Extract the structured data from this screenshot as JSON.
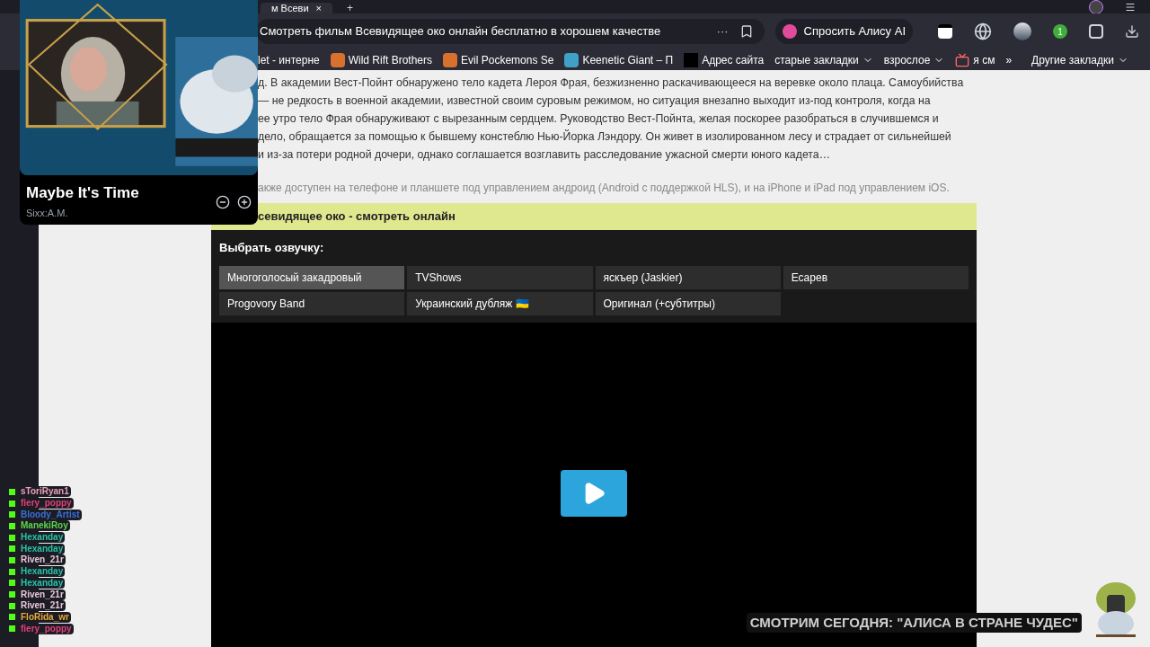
{
  "browser": {
    "tab": {
      "title": "м Всеви",
      "close": "×"
    },
    "new_tab": "+",
    "address": "Смотреть фильм Всевидящее око онлайн бесплатно в хорошем качестве",
    "more": "···",
    "alice_button": "Спросить Алису AI",
    "extension_badge": "1",
    "bookmarks": [
      {
        "kind": "plain",
        "label": "let - интерне"
      },
      {
        "kind": "logo",
        "label": "Wild Rift Brothers"
      },
      {
        "kind": "logo",
        "label": "Evil Pockemons Se"
      },
      {
        "kind": "k",
        "label": "Keenetic Giant – П"
      },
      {
        "kind": "w",
        "label": "Адрес сайта"
      },
      {
        "kind": "folder",
        "label": "старые закладки"
      },
      {
        "kind": "folder",
        "label": "взрослое"
      },
      {
        "kind": "tv",
        "label": "я см"
      }
    ],
    "bookmarks_more": "»",
    "other_bookmarks": "Другие закладки"
  },
  "page": {
    "description_lines": [
      "д. В академии Вест-Пойнт обнаружено тело кадета Лероя Фрая, безжизненно раскачивающееся на веревке около плаца. Самоубийства",
      "— не редкость в военной академии, известной своим суровым режимом, но ситуация внезапно выходит из-под контроля, когда на",
      "ее утро тело Фрая обнаруживают с вырезанным сердцем. Руководство Вест-Пойнта, желая поскорее разобраться в случившемся и",
      "дело, обращается за помощью к бывшему констеблю Нью-Йорка Лэндору. Он живет в изолированном лесу и страдает от сильнейшей",
      "и из-за потери родной дочери, однако соглашается возглавить расследование ужасной смерти юного кадета…"
    ],
    "note": "акже доступен на телефоне и планшете под управлением андроид (Android с поддержкой HLS), и на iPhone и iPad под управлением iOS.",
    "section_heading": "севидящее око - смотреть онлайн",
    "voice_title": "Выбрать озвучку:",
    "voices": [
      {
        "label": "Многоголосый закадровый",
        "selected": true
      },
      {
        "label": "TVShows",
        "selected": false
      },
      {
        "label": "яскъер (Jaskier)",
        "selected": false
      },
      {
        "label": "Есарев",
        "selected": false
      },
      {
        "label": "Progovory Band",
        "selected": false
      },
      {
        "label": "Украинский дубляж 🇺🇦",
        "selected": false
      },
      {
        "label": "Оригинал (+субтитры)",
        "selected": false
      }
    ]
  },
  "now_playing": {
    "title": "Maybe It's Time",
    "artist": "Sixx:A.M."
  },
  "chat": [
    {
      "name": "sToriRyan1",
      "color": "#e8a0b8"
    },
    {
      "name": "fiery_poppy",
      "color": "#e0407a"
    },
    {
      "name": "Bloody_Artist",
      "color": "#3a6fd8"
    },
    {
      "name": "ManekiRoy",
      "color": "#5cd64a"
    },
    {
      "name": "Hexanday",
      "color": "#27c4a8"
    },
    {
      "name": "Hexanday",
      "color": "#27c4a8"
    },
    {
      "name": "Riven_21r",
      "color": "#e8c8d8"
    },
    {
      "name": "Hexanday",
      "color": "#27c4a8"
    },
    {
      "name": "Hexanday",
      "color": "#27c4a8"
    },
    {
      "name": "Riven_21r",
      "color": "#e8c8d8"
    },
    {
      "name": "Riven_21r",
      "color": "#e8c8d8"
    },
    {
      "name": "FloRida_wr",
      "color": "#e8a83a"
    },
    {
      "name": "fiery_poppy",
      "color": "#e0407a"
    }
  ],
  "caption": "СМОТРИМ СЕГОДНЯ: \"АЛИСА В СТРАНЕ ЧУДЕС\""
}
